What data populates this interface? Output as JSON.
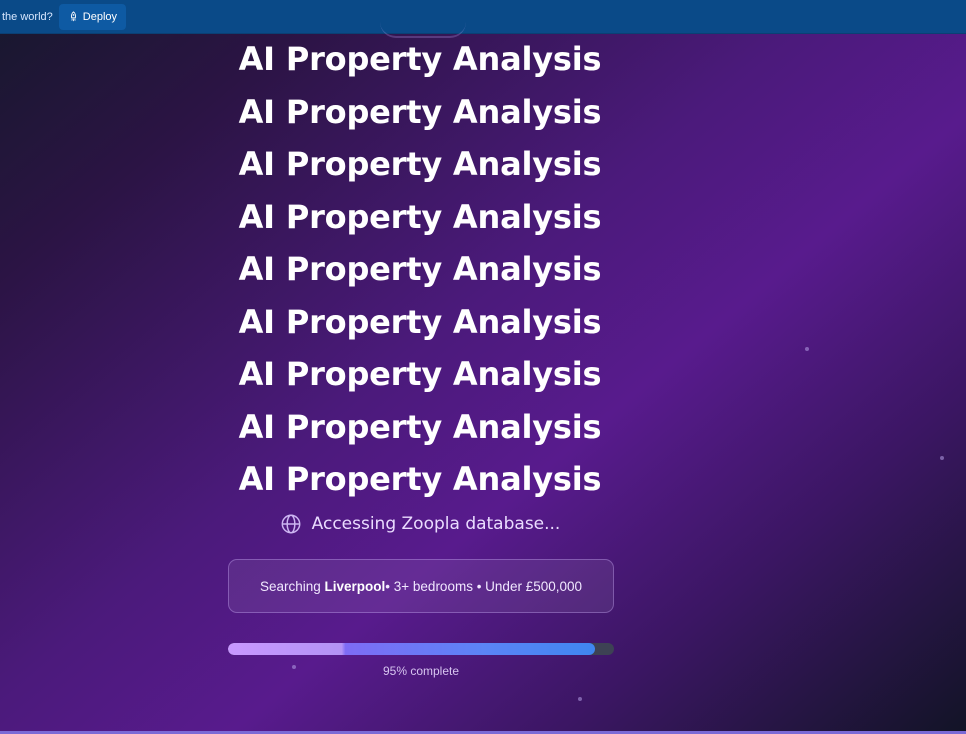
{
  "topbar": {
    "prompt_text": "the world?",
    "deploy_label": "Deploy"
  },
  "title_lines": [
    "AI Property Analysis",
    "AI Property Analysis",
    "AI Property Analysis",
    "AI Property Analysis",
    "AI Property Analysis",
    "AI Property Analysis",
    "AI Property Analysis",
    "AI Property Analysis",
    "AI Property Analysis"
  ],
  "status": {
    "icon": "globe-icon",
    "text": "Accessing Zoopla database..."
  },
  "search": {
    "prefix": "Searching",
    "location": "Liverpool",
    "criteria": " • 3+ bedrooms • Under £500,000"
  },
  "progress": {
    "value_percent": 95,
    "label": "95% complete"
  },
  "colors": {
    "topbar": "#0a4a88",
    "accent_purple": "#c898ff",
    "accent_blue": "#3f86f0"
  }
}
